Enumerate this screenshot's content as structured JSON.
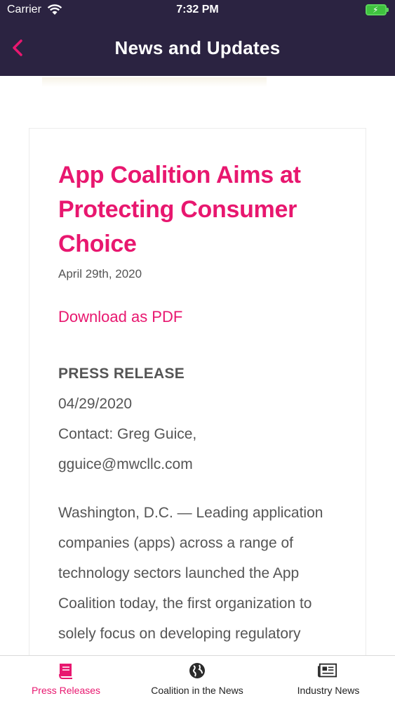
{
  "status_bar": {
    "carrier": "Carrier",
    "time": "7:32 PM"
  },
  "nav": {
    "title": "News and Updates"
  },
  "article": {
    "title": "App Coalition Aims at Protecting Consumer Choice",
    "date": "April 29th, 2020",
    "pdf_link": "Download as PDF",
    "press_label": "PRESS RELEASE",
    "release_date": "04/29/2020",
    "contact": "Contact: Greg Guice,",
    "email": "gguice@mwcllc.com",
    "body": "Washington, D.C. — Leading application companies (apps) across a range of technology sectors launched the App Coalition today, the first organization to solely focus on developing regulatory policies and"
  },
  "tabs": [
    {
      "label": "Press Releases",
      "icon": "book-icon",
      "active": true
    },
    {
      "label": "Coalition in the News",
      "icon": "globe-icon",
      "active": false
    },
    {
      "label": "Industry News",
      "icon": "newspaper-icon",
      "active": false
    }
  ],
  "colors": {
    "nav_background": "#2b2341",
    "accent": "#e8176f",
    "body_text": "#555555"
  }
}
